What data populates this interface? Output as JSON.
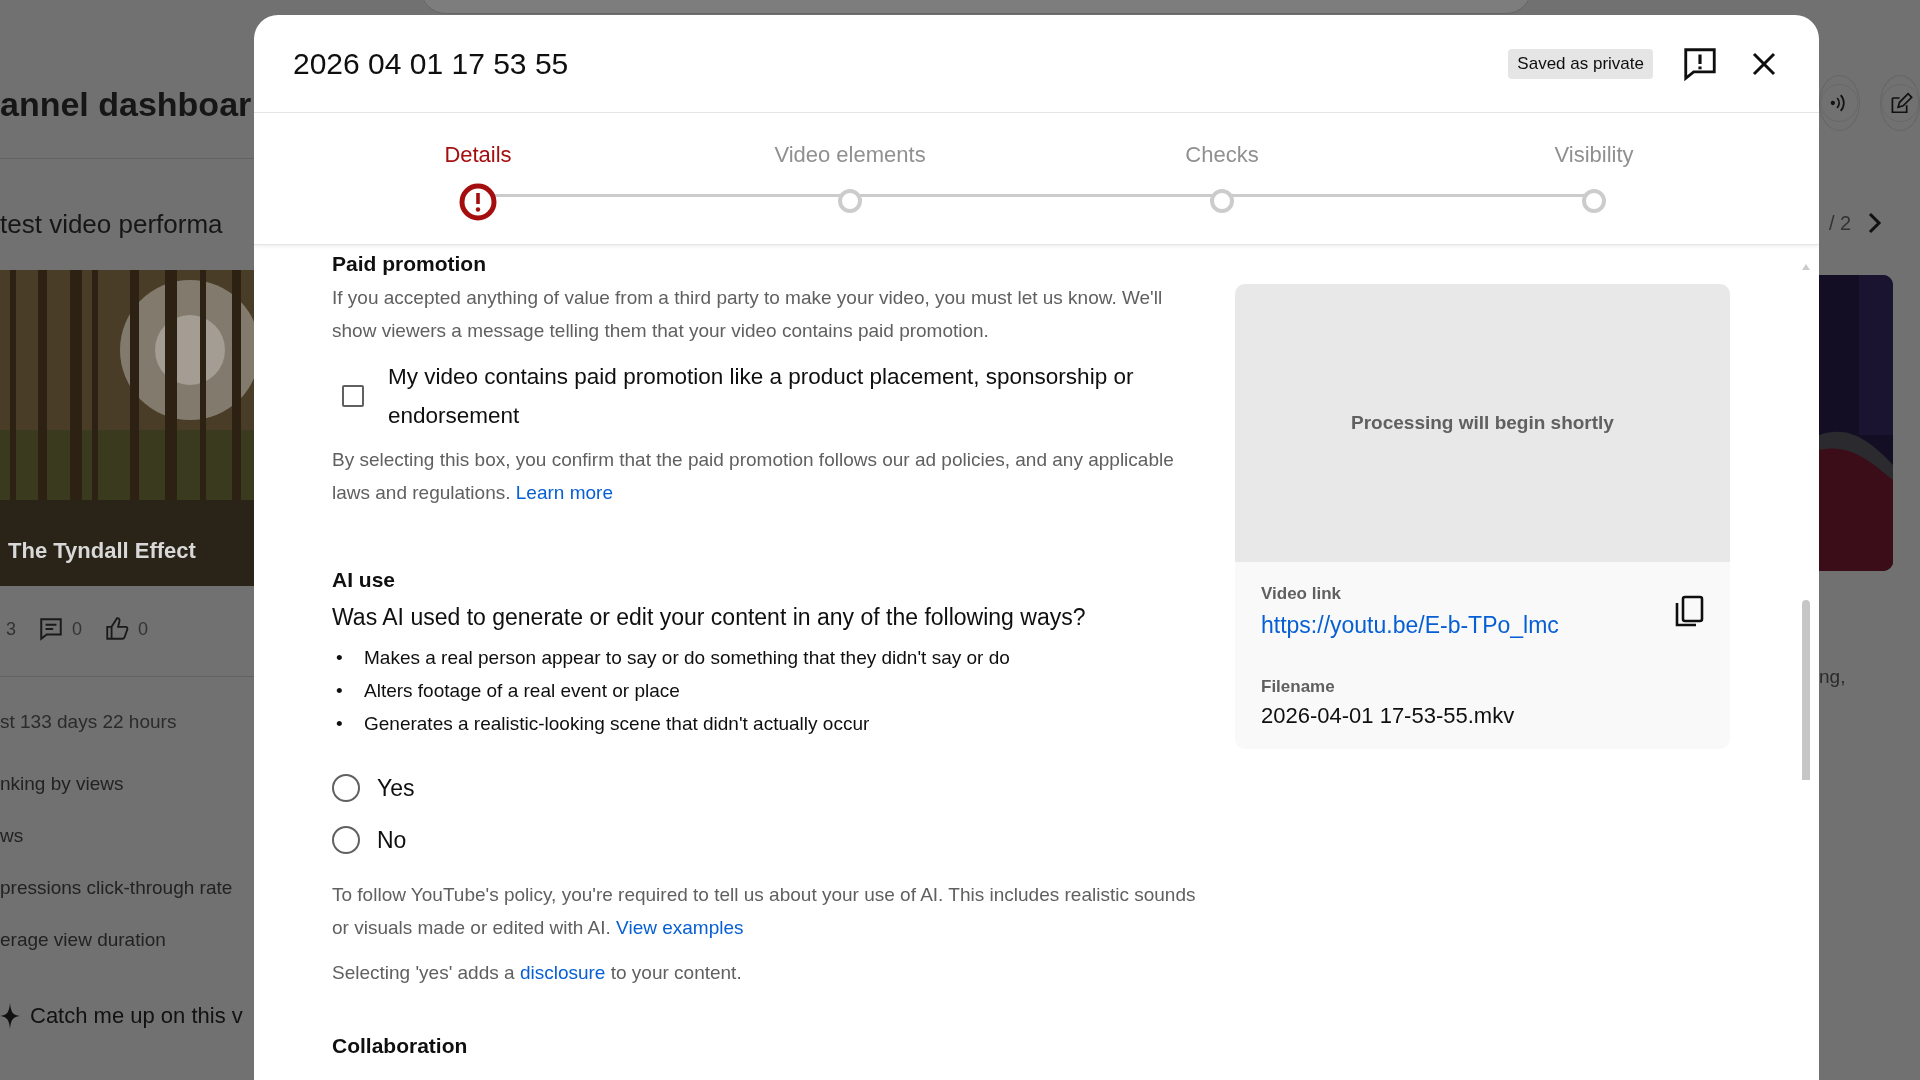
{
  "background": {
    "page_title": "annel dashboar",
    "section_title": "test video performa",
    "video_title": "The Tyndall Effect",
    "stats": [
      {
        "kind": "views",
        "value": "3"
      },
      {
        "kind": "comments",
        "value": "0"
      },
      {
        "kind": "likes",
        "value": "0"
      }
    ],
    "period": "st 133 days 22 hours",
    "metrics": [
      "nking by views",
      "ws",
      "pressions click-through rate",
      "erage view duration"
    ],
    "summary_button": "Catch me up on this v",
    "pager": "/ 2",
    "side_text": "ng,"
  },
  "dialog": {
    "title": "2026 04 01 17 53 55",
    "save_status": "Saved as private",
    "steps": [
      {
        "label": "Details",
        "selected": true,
        "has_error": true
      },
      {
        "label": "Video elements",
        "selected": false,
        "has_error": false
      },
      {
        "label": "Checks",
        "selected": false,
        "has_error": false
      },
      {
        "label": "Visibility",
        "selected": false,
        "has_error": false
      }
    ],
    "paid_promotion": {
      "heading": "Paid promotion",
      "description": "If you accepted anything of value from a third party to make your video, you must let us know. We'll show viewers a message telling them that your video contains paid promotion.",
      "checkbox": {
        "label": "My video contains paid promotion like a product placement, sponsorship or endorsement",
        "checked": false
      },
      "note": "By selecting this box, you confirm that the paid promotion follows our ad policies, and any applicable laws and regulations.",
      "note_link": "Learn more"
    },
    "ai_use": {
      "heading": "AI use",
      "question": "Was AI used to generate or edit your content in any of the following ways?",
      "bullets": [
        {
          "marker": "•",
          "text": "Makes a real person appear to say or do something that they didn't say or do"
        },
        {
          "marker": "•",
          "text": "Alters footage of a real event or place"
        },
        {
          "marker": "•",
          "text": "Generates a realistic-looking scene that didn't actually occur"
        }
      ],
      "options": [
        {
          "label": "Yes",
          "selected": false
        },
        {
          "label": "No",
          "selected": false
        }
      ],
      "policy": "To follow YouTube's policy, you're required to tell us about your use of AI. This includes realistic sounds or visuals made or edited with AI.",
      "policy_link": "View examples",
      "disclosure_before": "Selecting 'yes' adds a",
      "disclosure_link": "disclosure",
      "disclosure_after": "to your content."
    },
    "collaboration": {
      "heading": "Collaboration"
    },
    "preview": {
      "status": "Processing will begin shortly",
      "link_label": "Video link",
      "link": "https://youtu.be/E-b-TPo_lmc",
      "filename_label": "Filename",
      "filename": "2026-04-01 17-53-55.mkv"
    }
  }
}
